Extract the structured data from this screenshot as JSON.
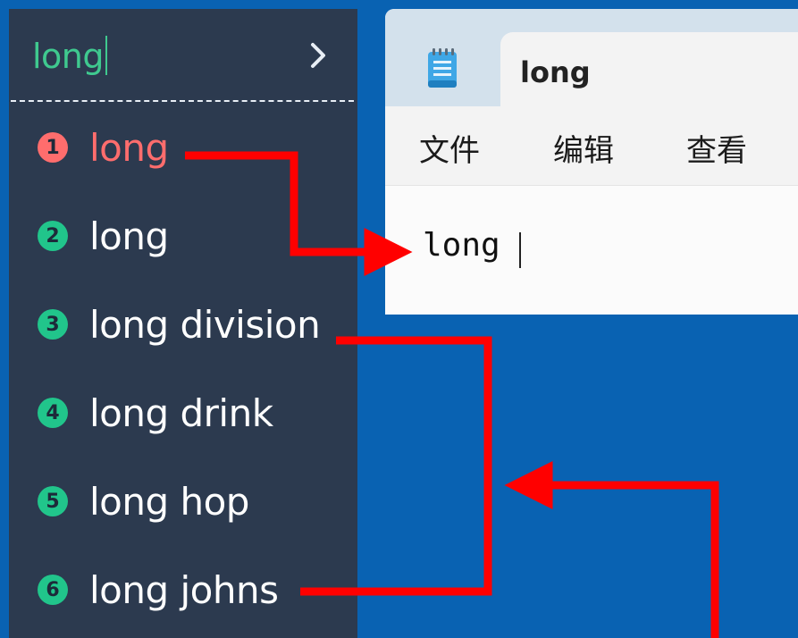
{
  "ime": {
    "input_text": "long",
    "candidates": [
      {
        "number": "1",
        "text": "long",
        "selected": true
      },
      {
        "number": "2",
        "text": "long",
        "selected": false
      },
      {
        "number": "3",
        "text": "long division",
        "selected": false
      },
      {
        "number": "4",
        "text": "long drink",
        "selected": false
      },
      {
        "number": "5",
        "text": "long hop",
        "selected": false
      },
      {
        "number": "6",
        "text": "long johns",
        "selected": false
      }
    ]
  },
  "notepad": {
    "tab_title": "long",
    "menu": {
      "file": "文件",
      "edit": "编辑",
      "view": "查看"
    },
    "editor_text": "long"
  },
  "colors": {
    "desktop": "#0962b2",
    "ime_panel": "#2c3a4f",
    "input_accent": "#3fc98f",
    "selected_candidate": "#ff6d6d",
    "candidate_number": "#21c58b",
    "annotation_arrow": "#ff0000"
  }
}
